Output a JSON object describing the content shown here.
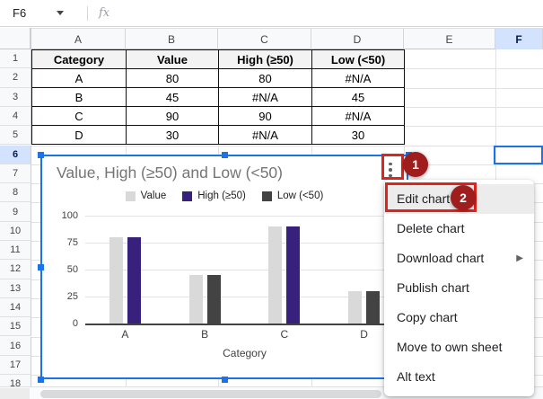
{
  "formula_bar": {
    "cell_reference": "F6",
    "fx_label": "fx"
  },
  "sheet": {
    "column_headers": [
      "A",
      "B",
      "C",
      "D",
      "E",
      "F"
    ],
    "row_headers": [
      "1",
      "2",
      "3",
      "4",
      "5",
      "6",
      "7",
      "8",
      "9",
      "10",
      "11",
      "12",
      "13",
      "14",
      "15",
      "16",
      "17",
      "18"
    ],
    "selected_column": "F",
    "selected_row": "6",
    "selected_cell": "F6"
  },
  "table": {
    "headers": [
      "Category",
      "Value",
      "High (≥50)",
      "Low (<50)"
    ],
    "rows": [
      [
        "A",
        "80",
        "80",
        "#N/A"
      ],
      [
        "B",
        "45",
        "#N/A",
        "45"
      ],
      [
        "C",
        "90",
        "90",
        "#N/A"
      ],
      [
        "D",
        "30",
        "#N/A",
        "30"
      ]
    ]
  },
  "chart_data": {
    "type": "bar",
    "title": "Value, High (≥50) and Low (<50)",
    "categories": [
      "A",
      "B",
      "C",
      "D"
    ],
    "series": [
      {
        "name": "Value",
        "color": "#d9d9d9",
        "values": [
          80,
          45,
          90,
          30
        ]
      },
      {
        "name": "High (≥50)",
        "color": "#38217c",
        "values": [
          80,
          null,
          90,
          null
        ]
      },
      {
        "name": "Low (<50)",
        "color": "#434343",
        "values": [
          null,
          45,
          null,
          30
        ]
      }
    ],
    "xlabel": "Category",
    "ylabel": "",
    "y_ticks": [
      0,
      25,
      50,
      75,
      100
    ],
    "ylim": [
      0,
      100
    ],
    "grid": true,
    "legend_position": "top"
  },
  "context_menu": {
    "items": [
      {
        "label": "Edit chart",
        "highlighted": true,
        "submenu": false
      },
      {
        "label": "Delete chart",
        "highlighted": false,
        "submenu": false
      },
      {
        "label": "Download chart",
        "highlighted": false,
        "submenu": true
      },
      {
        "label": "Publish chart",
        "highlighted": false,
        "submenu": false
      },
      {
        "label": "Copy chart",
        "highlighted": false,
        "submenu": false
      },
      {
        "label": "Move to own sheet",
        "highlighted": false,
        "submenu": false
      },
      {
        "label": "Alt text",
        "highlighted": false,
        "submenu": false
      }
    ]
  },
  "annotations": {
    "step1": "1",
    "step2": "2"
  },
  "colors": {
    "selection_blue": "#1a73e8",
    "annotation_red": "#df241d",
    "badge_red": "#9f1d1d",
    "selected_header_bg": "#d3e3fd",
    "bar_value": "#d9d9d9",
    "bar_high": "#38217c",
    "bar_low": "#434343"
  }
}
